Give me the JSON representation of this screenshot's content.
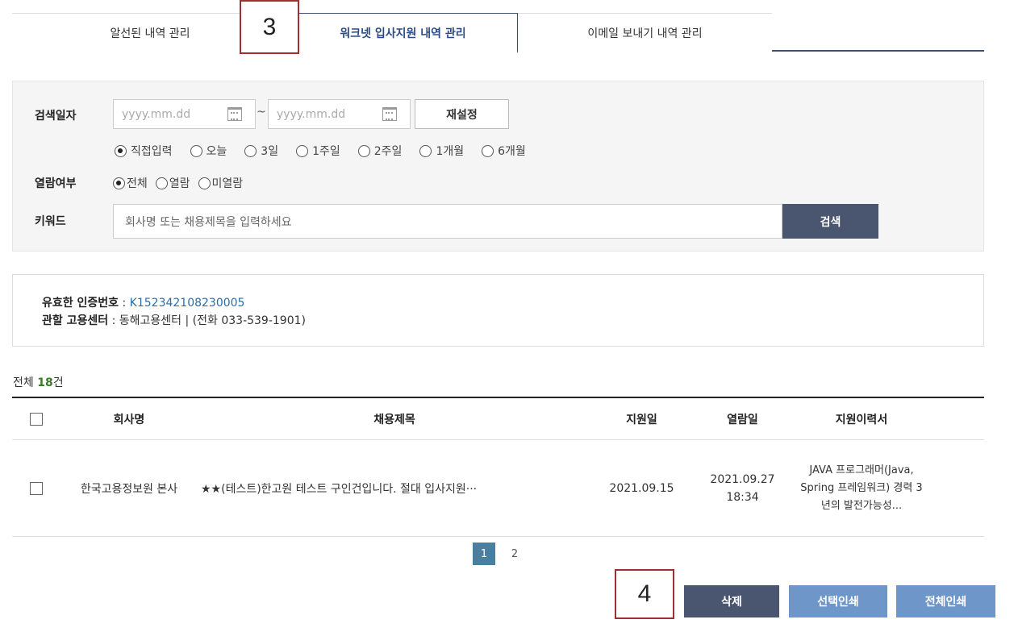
{
  "tabs": [
    {
      "label": "알선된 내역 관리"
    },
    {
      "label": "워크넷 입사지원 내역 관리"
    },
    {
      "label": "이메일 보내기 내역 관리"
    }
  ],
  "annotations": {
    "step3": "3",
    "step4": "4"
  },
  "search": {
    "date_label": "검색일자",
    "date_placeholder": "yyyy.mm.dd",
    "tilde": "~",
    "reset_label": "재설정",
    "period_options": [
      "직접입력",
      "오늘",
      "3일",
      "1주일",
      "2주일",
      "1개월",
      "6개월"
    ],
    "period_selected": "직접입력",
    "read_label": "열람여부",
    "read_options": [
      "전체",
      "열람",
      "미열람"
    ],
    "read_selected": "전체",
    "keyword_label": "키워드",
    "keyword_placeholder": "회사명 또는 채용제목을 입력하세요",
    "search_label": "검색"
  },
  "info": {
    "cert_label": "유효한 인증번호",
    "cert_sep": " : ",
    "cert_value": "K152342108230005",
    "center_label": "관할 고용센터",
    "center_value": " : 동해고용센터 | (전화 033-539-1901)"
  },
  "count": {
    "prefix": "전체 ",
    "value": "18",
    "suffix": "건"
  },
  "table": {
    "headers": {
      "company": "회사명",
      "title": "채용제목",
      "applied": "지원일",
      "viewed": "열람일",
      "resume": "지원이력서"
    },
    "rows": [
      {
        "company": "한국고용정보원 본사",
        "title": "★★(테스트)한고원 테스트 구인건입니다. 절대 입사지원···",
        "applied": "2021.09.15",
        "viewed_date": "2021.09.27",
        "viewed_time": "18:34",
        "resume": "JAVA 프로그래머(Java, Spring 프레임워크) 경력 3년의 발전가능성..."
      }
    ]
  },
  "pagination": {
    "pages": [
      "1",
      "2"
    ],
    "current": "1"
  },
  "buttons": {
    "delete": "삭제",
    "print_selected": "선택인쇄",
    "print_all": "전체인쇄"
  }
}
